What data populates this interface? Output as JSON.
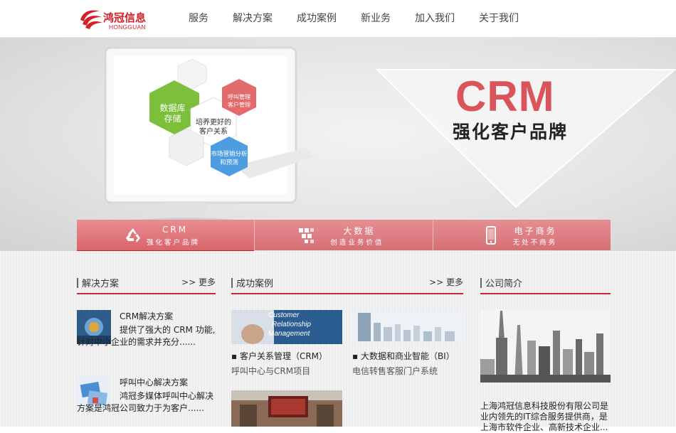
{
  "header": {
    "logo_cn": "鸿冠信息",
    "logo_en": "HONGGUAN",
    "nav": [
      "服务",
      "解决方案",
      "成功案例",
      "新业务",
      "加入我们",
      "关于我们"
    ]
  },
  "banner": {
    "title": "CRM",
    "subtitle": "强化客户品牌",
    "hex_labels": {
      "green": [
        "数据库",
        "存储"
      ],
      "center": [
        "培养更好的",
        "客户关系"
      ],
      "red": [
        "呼叫管理",
        "客户管理"
      ],
      "blue": [
        "市场营销分析",
        "和预测"
      ]
    }
  },
  "tabs": [
    {
      "title": "CRM",
      "sub": "强化客户品牌",
      "icon": "recycle-icon"
    },
    {
      "title": "大数据",
      "sub": "创造业务价值",
      "icon": "data-blocks-icon"
    },
    {
      "title": "电子商务",
      "sub": "无处不商务",
      "icon": "mobile-phone-icon"
    }
  ],
  "solutions": {
    "title": "解决方案",
    "more": "更多",
    "items": [
      {
        "title": "CRM解决方案",
        "desc": "提供了强大的 CRM 功能,针对中小企业的需求并充分......"
      },
      {
        "title": "呼叫中心解决方案",
        "desc": "鸿冠多媒体呼叫中心解决方案是鸿冠公司致力于为客户......"
      }
    ]
  },
  "cases": {
    "title": "成功案例",
    "more": "更多",
    "items": [
      {
        "title": "▪ 客户关系管理（CRM）",
        "sub": "呼叫中心与CRM项目",
        "img_text": [
          "Customer",
          "Relationship",
          "Management"
        ]
      },
      {
        "title": "▪ 大数据和商业智能（BI）",
        "sub": "电信转售客服门户系统"
      }
    ]
  },
  "about": {
    "title": "公司简介",
    "text": "上海鸿冠信息科技股份有限公司是业内领先的IT综合服务提供商，是上海市软件企业、高新技术企业..."
  },
  "colors": {
    "accent": "#d4202a",
    "tab_bg": "#dc7a7e",
    "crm_title": "#d9555b"
  }
}
